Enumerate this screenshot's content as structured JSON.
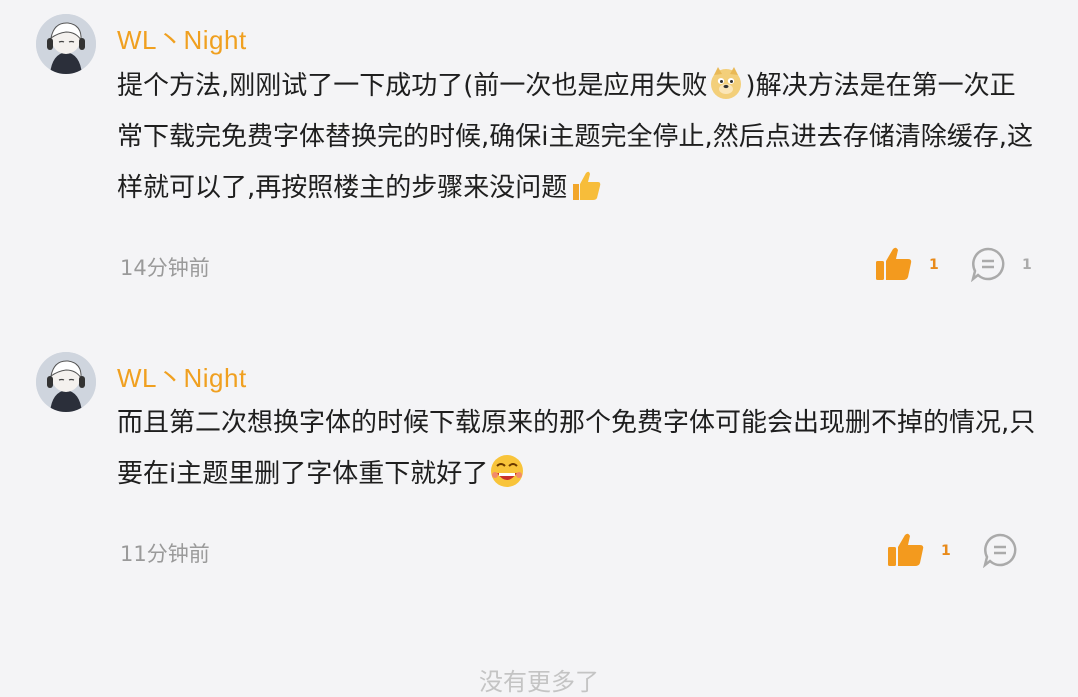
{
  "comments": [
    {
      "username": "WL丶Night",
      "text_parts": [
        "提个方法,刚刚试了一下成功了(前一次也是应用失败",
        ")解决方法是在第一次正常下载完免费字体替换完的时候,确保i主题完全停止,然后点进去存储清除缓存,这样就可以了,再按照楼主的步骤来没问题",
        ""
      ],
      "emojis": [
        "doge-emoji",
        "thumbs-up-emoji"
      ],
      "time": "14分钟前",
      "like_count": "1",
      "reply_count": "1"
    },
    {
      "username": "WL丶Night",
      "text_parts": [
        "而且第二次想换字体的时候下载原来的那个免费字体可能会出现删不掉的情况,只要在i主题里删了字体重下就好了",
        ""
      ],
      "emojis": [
        "grin-emoji"
      ],
      "time": "11分钟前",
      "like_count": "1",
      "reply_count": ""
    }
  ],
  "footer": {
    "no_more": "没有更多了"
  },
  "colors": {
    "accent": "#f0a020",
    "background": "#f4f4f6",
    "like_icon": "#f39a1e",
    "meta_text": "#9a9a9a"
  }
}
